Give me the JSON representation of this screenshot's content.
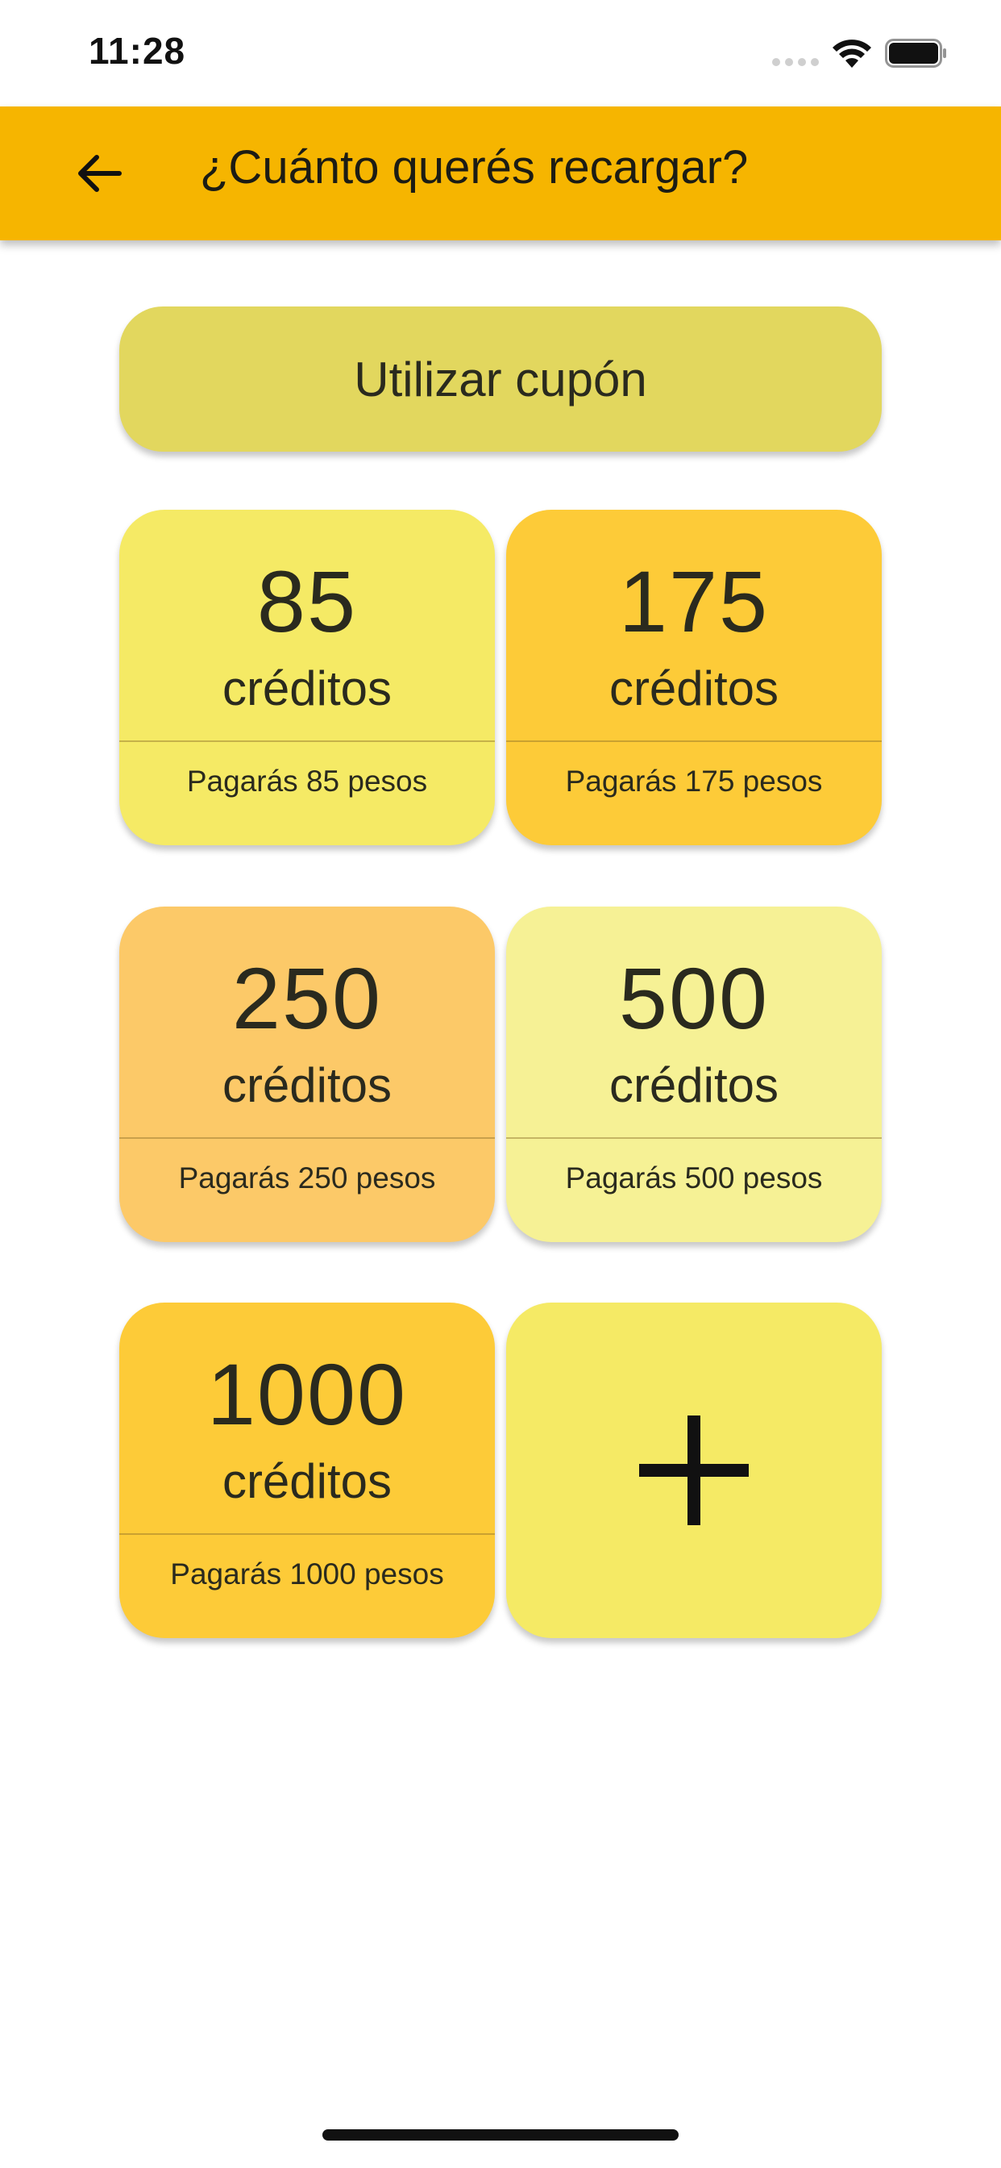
{
  "status_bar": {
    "time": "11:28"
  },
  "app_bar": {
    "title": "¿Cuánto querés recargar?",
    "back_icon": "arrow-left-icon"
  },
  "coupon": {
    "label": "Utilizar cupón"
  },
  "packages": [
    {
      "amount": "85",
      "unit": "créditos",
      "price": "Pagarás 85 pesos",
      "color": "#f5ea65"
    },
    {
      "amount": "175",
      "unit": "créditos",
      "price": "Pagarás 175 pesos",
      "color": "#fdcb38"
    },
    {
      "amount": "250",
      "unit": "créditos",
      "price": "Pagarás 250 pesos",
      "color": "#fcc968"
    },
    {
      "amount": "500",
      "unit": "créditos",
      "price": "Pagarás 500 pesos",
      "color": "#f6f195"
    },
    {
      "amount": "1000",
      "unit": "créditos",
      "price": "Pagarás 1000 pesos",
      "color": "#fdcb38"
    }
  ],
  "custom_tile": {
    "icon": "plus-icon",
    "color": "#f5ea65"
  },
  "colors": {
    "app_bar": "#f6b500",
    "coupon": "#e2d75e"
  }
}
